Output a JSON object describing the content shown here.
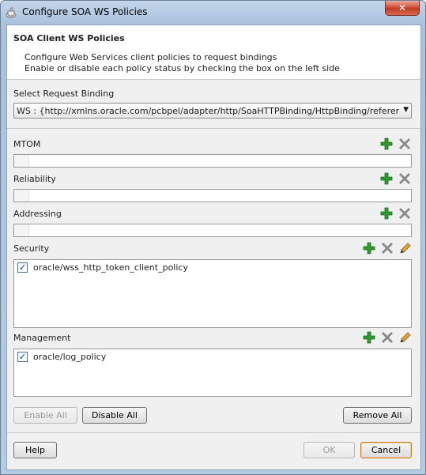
{
  "window": {
    "title": "Configure SOA WS Policies"
  },
  "header": {
    "title": "SOA Client WS Policies",
    "line1": "Configure Web Services client policies to request bindings",
    "line2": "Enable or disable each policy status by checking the box on the left side"
  },
  "binding": {
    "label": "Select Request Binding",
    "selected": "WS : {http://xmlns.oracle.com/pcbpel/adapter/http/SoaHTTPBinding/HttpBinding/reference}reference"
  },
  "sections": {
    "mtom": {
      "label": "MTOM"
    },
    "reliability": {
      "label": "Reliability"
    },
    "addressing": {
      "label": "Addressing"
    },
    "security": {
      "label": "Security",
      "items": [
        {
          "name": "oracle/wss_http_token_client_policy",
          "checked": true
        }
      ]
    },
    "management": {
      "label": "Management",
      "items": [
        {
          "name": "oracle/log_policy",
          "checked": true
        }
      ]
    }
  },
  "buttons": {
    "enable_all": "Enable All",
    "disable_all": "Disable All",
    "remove_all": "Remove All",
    "help": "Help",
    "ok": "OK",
    "cancel": "Cancel"
  },
  "icons": {
    "add": "plus-icon",
    "remove": "delete-x-icon",
    "edit": "pencil-icon",
    "colors": {
      "add": "#2e9a2e",
      "remove": "#8a8a8a",
      "edit": "#c8861a",
      "close": "#c8432b"
    }
  }
}
